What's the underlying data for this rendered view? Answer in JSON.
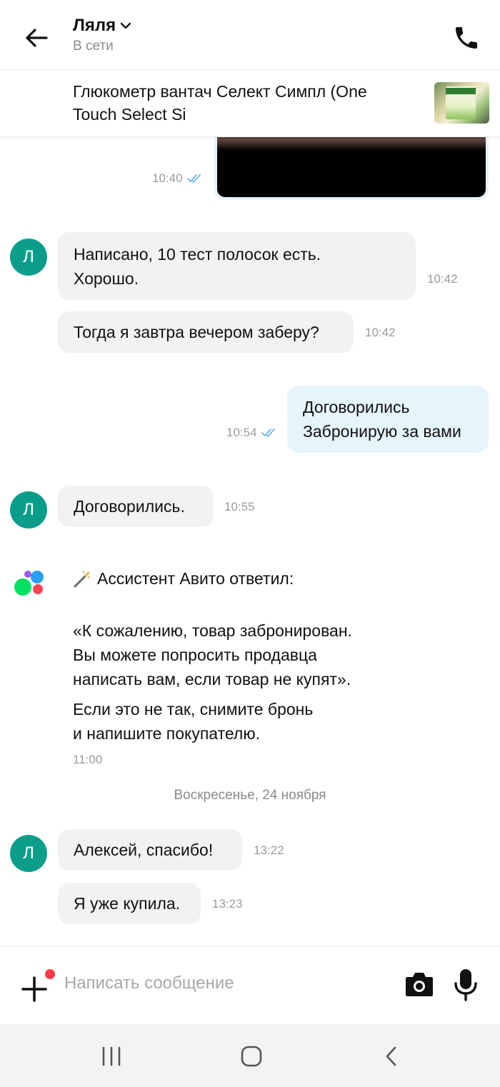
{
  "header": {
    "title": "Ляля",
    "status": "В сети",
    "icons": {
      "back": "arrow-left-icon",
      "call": "phone-icon",
      "chevron": "chevron-down-icon"
    }
  },
  "product": {
    "title": "Глюкометр вантач Селект Симпл (One Touch Select Si"
  },
  "messages": {
    "m0_time": "10:40",
    "m1_line1": "Написано, 10 тест полосок есть.",
    "m1_line2": "Хорошо.",
    "m1_time": "10:42",
    "m2_text": "Тогда я завтра вечером заберу?",
    "m2_time": "10:42",
    "m3_line1": "Договорились",
    "m3_line2": "Забронирую за вами",
    "m3_time": "10:54",
    "m4_text": "Договорились.",
    "m4_time": "10:55",
    "m6_text": "Алексей, спасибо!",
    "m6_time": "13:22",
    "m7_text": "Я уже купила.",
    "m7_time": "13:23"
  },
  "avatar_letter": "Л",
  "assistant": {
    "heading": "Ассистент Авито ответил:",
    "quote_line1": "«К сожалению, товар забронирован.",
    "quote_line2": "Вы можете попросить продавца",
    "quote_line3": "написать вам, если товар не купят».",
    "note_line1": "Если это не так, снимите бронь",
    "note_line2": "и напишите покупателю.",
    "time": "11:00"
  },
  "date_separator": "Воскресенье, 24 ноября",
  "input": {
    "placeholder": "Написать сообщение",
    "value": ""
  },
  "colors": {
    "accent": "#0a9e8a",
    "outgoing_bubble": "#e6f4fc",
    "incoming_bubble": "#f2f2f2",
    "read_ticks": "#69b7e8",
    "notification_dot": "#ff3a4a"
  }
}
